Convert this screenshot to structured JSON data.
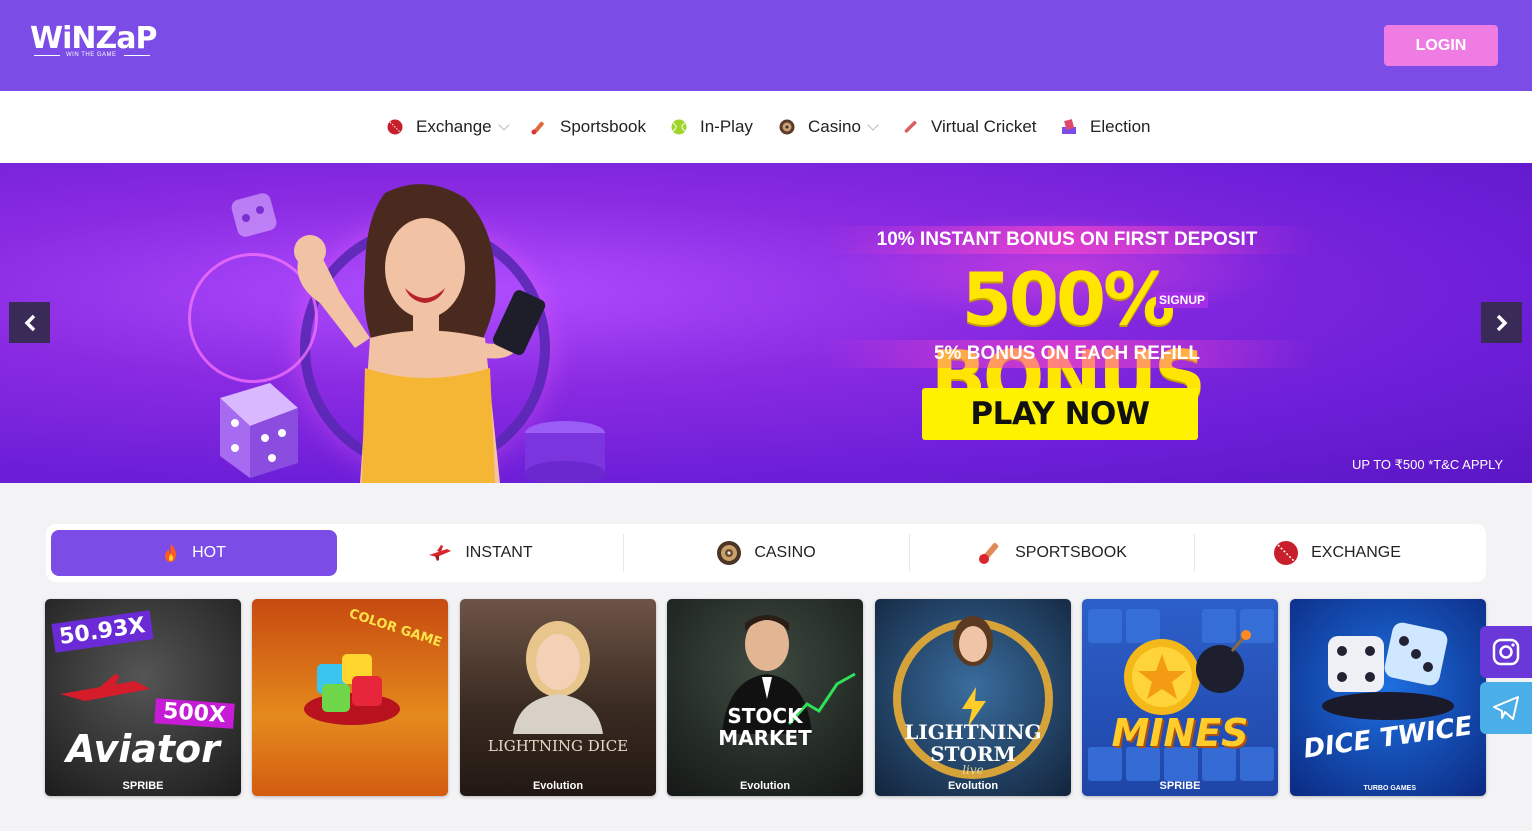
{
  "header": {
    "logo_text": "WiNZaP",
    "logo_tagline": "WIN THE GAME",
    "login_label": "LOGIN"
  },
  "nav": {
    "items": [
      {
        "label": "Exchange",
        "icon": "cricket-ball-icon",
        "has_dropdown": true
      },
      {
        "label": "Sportsbook",
        "icon": "cricket-bat-icon",
        "has_dropdown": false
      },
      {
        "label": "In-Play",
        "icon": "tennis-ball-icon",
        "has_dropdown": false
      },
      {
        "label": "Casino",
        "icon": "roulette-icon",
        "has_dropdown": true
      },
      {
        "label": "Virtual Cricket",
        "icon": "bat-icon",
        "has_dropdown": false
      },
      {
        "label": "Election",
        "icon": "ballot-icon",
        "has_dropdown": false
      }
    ]
  },
  "banner": {
    "top_line": "10% INSTANT BONUS ON FIRST DEPOSIT",
    "headline": "500% BONUS",
    "signup_tag": "SIGNUP",
    "sub_line": "5% BONUS ON EACH REFILL",
    "cta": "PLAY NOW",
    "terms": "UP TO ₹500 *T&C APPLY"
  },
  "tabs": [
    {
      "label": "HOT",
      "icon": "flame-icon",
      "active": true
    },
    {
      "label": "INSTANT",
      "icon": "plane-icon",
      "active": false
    },
    {
      "label": "CASINO",
      "icon": "roulette-icon",
      "active": false
    },
    {
      "label": "SPORTSBOOK",
      "icon": "cricket-bat-icon",
      "active": false
    },
    {
      "label": "EXCHANGE",
      "icon": "cricket-ball-icon",
      "active": false
    }
  ],
  "games": [
    {
      "title": "Aviator",
      "badge": "50.93X",
      "multiplier": "500X",
      "brand": "SPRIBE"
    },
    {
      "title": "COLOR GAME",
      "brand": ""
    },
    {
      "title": "LIGHTNING DICE",
      "brand": "Evolution"
    },
    {
      "title": "STOCK MARKET",
      "brand": "Evolution"
    },
    {
      "title": "LIGHTNING STORM",
      "subtitle": "live",
      "brand": "Evolution"
    },
    {
      "title": "MINES",
      "brand": "SPRIBE"
    },
    {
      "title": "DICE TWICE",
      "brand": "TURBO GAMES"
    }
  ],
  "colors": {
    "brand_purple": "#7b4ce6",
    "login_pink": "#ef7ce2",
    "bonus_yellow": "#ffe600",
    "cta_yellow": "#fff200"
  }
}
